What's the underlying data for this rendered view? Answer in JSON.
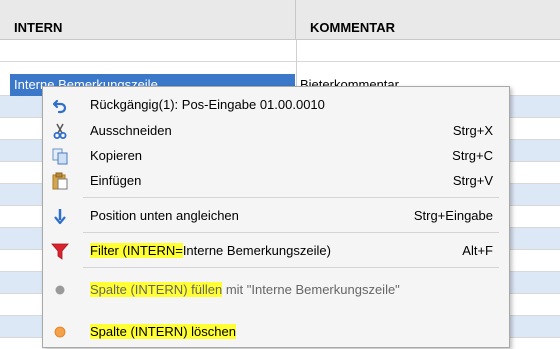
{
  "columns": {
    "intern": "INTERN",
    "kommentar": "KOMMENTAR"
  },
  "selected_row": {
    "intern_value": "Interne Bemerkungszeile",
    "kommentar_value": "Bieterkommentar"
  },
  "context_menu": {
    "undo": {
      "label": "Rückgängig(1): Pos-Eingabe 01.00.0010",
      "icon": "undo-icon"
    },
    "cut": {
      "label": "Ausschneiden",
      "shortcut": "Strg+X",
      "icon": "scissors-icon"
    },
    "copy": {
      "label": "Kopieren",
      "shortcut": "Strg+C",
      "icon": "copy-icon"
    },
    "paste": {
      "label": "Einfügen",
      "shortcut": "Strg+V",
      "icon": "clipboard-icon"
    },
    "align": {
      "label": "Position unten angleichen",
      "shortcut": "Strg+Eingabe",
      "icon": "arrow-down-icon"
    },
    "filter": {
      "label_highlight": "Filter (INTERN=",
      "label_rest": "Interne Bemerkungszeile)",
      "shortcut": "Alt+F",
      "icon": "filter-icon"
    },
    "fill": {
      "label_highlight": "Spalte (INTERN) füllen",
      "label_rest": " mit \"Interne Bemerkungszeile\"",
      "icon": "gray-dot-icon"
    },
    "delete": {
      "label": "Spalte (INTERN) löschen",
      "icon": "orange-dot-icon"
    }
  },
  "colors": {
    "highlight": "#ffff33",
    "selection": "#3b78c9",
    "alt_row": "#dde8f6",
    "filter_icon": "#d9232e",
    "delete_dot": "#f4a14b"
  }
}
